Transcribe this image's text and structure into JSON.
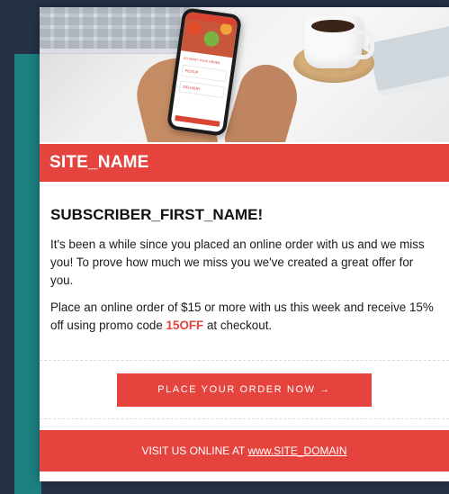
{
  "hero": {
    "phone_row_pickup": "PICKUP",
    "phone_row_delivery": "DELIVERY",
    "phone_label": "SO WHAT YOUR ORDER"
  },
  "header": {
    "site_name": "SITE_NAME"
  },
  "body": {
    "greeting": "SUBSCRIBER_FIRST_NAME!",
    "paragraph_1": "It's been a while since you placed an online order with us and we miss you! To prove how much we miss you we've created a great offer for you.",
    "paragraph_2_before": "Place an online order of $15 or more with us this week and receive 15% off using promo code ",
    "promo_code": "15OFF",
    "paragraph_2_after": " at checkout."
  },
  "cta": {
    "label": "PLACE YOUR ORDER NOW →"
  },
  "footer": {
    "prefix": "VISIT US ONLINE AT ",
    "link": "www.SITE_DOMAIN"
  },
  "colors": {
    "brand_red": "#e4443d",
    "page_bg": "#253246",
    "teal_accent": "#1c7f80"
  }
}
